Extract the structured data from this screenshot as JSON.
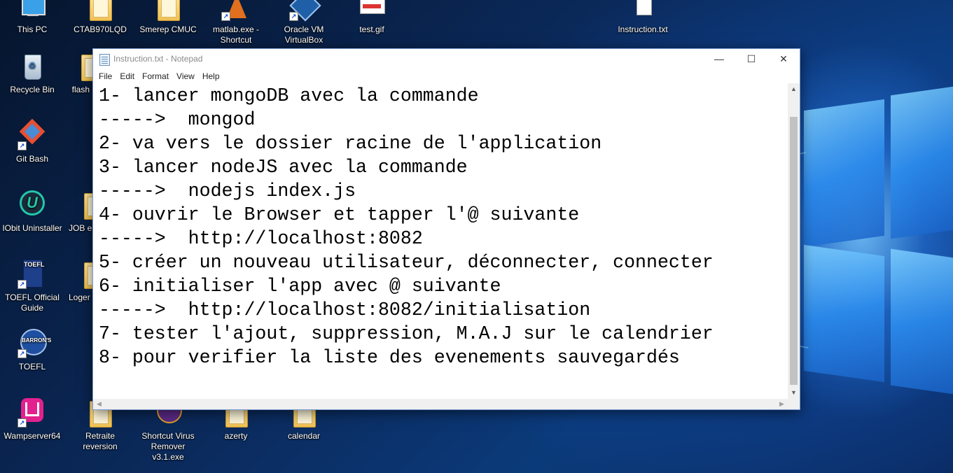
{
  "desktop": {
    "icons": [
      {
        "label": "This PC"
      },
      {
        "label": "CTAB970LQD"
      },
      {
        "label": "Smerep CMUC"
      },
      {
        "label": "matlab.exe - Shortcut"
      },
      {
        "label": "Oracle VM VirtualBox"
      },
      {
        "label": "test.gif"
      },
      {
        "label": "Instruction.txt"
      },
      {
        "label": "Recycle Bin"
      },
      {
        "label": "flash"
      },
      {
        "label": "Git Bash"
      },
      {
        "label": "IObit Uninstaller"
      },
      {
        "label": "JOB e"
      },
      {
        "label": "TOEFL Official Guide"
      },
      {
        "label": "Loger"
      },
      {
        "label": "TOEFL"
      },
      {
        "label": "Wampserver64"
      },
      {
        "label": "Retraite reversion"
      },
      {
        "label": "Shortcut Virus Remover v3.1.exe"
      },
      {
        "label": "azerty"
      },
      {
        "label": "calendar"
      }
    ]
  },
  "notepad": {
    "title": "Instruction.txt - Notepad",
    "controls": {
      "minimize": "—",
      "maximize": "☐",
      "close": "✕"
    },
    "menu": [
      "File",
      "Edit",
      "Format",
      "View",
      "Help"
    ],
    "lines": [
      "1- lancer mongoDB avec la commande",
      "----->  mongod",
      "2- va vers le dossier racine de l'application",
      "3- lancer nodeJS avec la commande",
      "----->  nodejs index.js",
      "4- ouvrir le Browser et tapper l'@ suivante",
      "----->  http://localhost:8082",
      "5- créer un nouveau utilisateur, déconnecter, connecter",
      "6- initialiser l'app avec @ suivante",
      "----->  http://localhost:8082/initialisation",
      "7- tester l'ajout, suppression, M.A.J sur le calendrier",
      "8- pour verifier la liste des evenements sauvegardés"
    ],
    "scroll": {
      "up": "▲",
      "down": "▼",
      "left": "◀",
      "right": "▶"
    }
  },
  "colors": {
    "accent": "#1a63c8",
    "window_border": "#7a9bd1"
  }
}
